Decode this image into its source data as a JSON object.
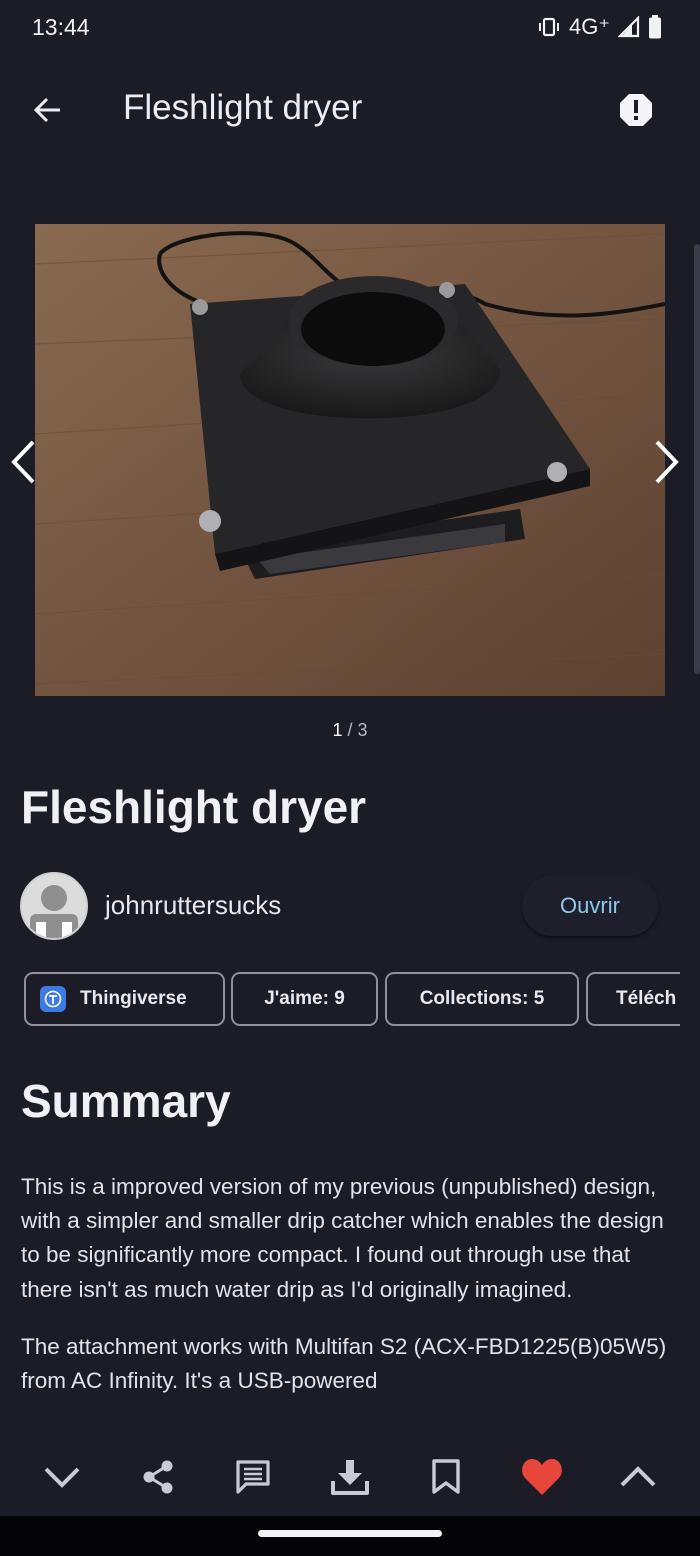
{
  "status": {
    "time": "13:44",
    "network": "4G⁺"
  },
  "appbar": {
    "title": "Fleshlight dryer"
  },
  "gallery": {
    "current": "1",
    "separator": "/",
    "total": "3"
  },
  "thing": {
    "title": "Fleshlight dryer"
  },
  "author": {
    "name": "johnruttersucks",
    "open_label": "Ouvrir"
  },
  "chips": {
    "source": "Thingiverse",
    "likes": "J'aime: 9",
    "collections": "Collections: 5",
    "downloads": "Téléch"
  },
  "summary": {
    "heading": "Summary",
    "paragraphs": [
      "This is a improved version of my previous (unpublished) design, with a simpler and smaller drip catcher which enables the design to be significantly more compact. I found out through use that there isn't as much water drip as I'd originally imagined.",
      "The attachment works with Multifan S2 (ACX-FBD1225(B)05W5) from AC Infinity. It's a USB-powered"
    ]
  },
  "colors": {
    "accent": "#8ec8ee",
    "like": "#e8463a",
    "background": "#1b1c26"
  },
  "icons": {
    "back": "arrow-left-icon",
    "report": "alert-octagon-icon",
    "bottom": [
      "chevron-down-icon",
      "share-icon",
      "comment-icon",
      "download-icon",
      "bookmark-icon",
      "heart-icon",
      "chevron-up-icon"
    ]
  }
}
